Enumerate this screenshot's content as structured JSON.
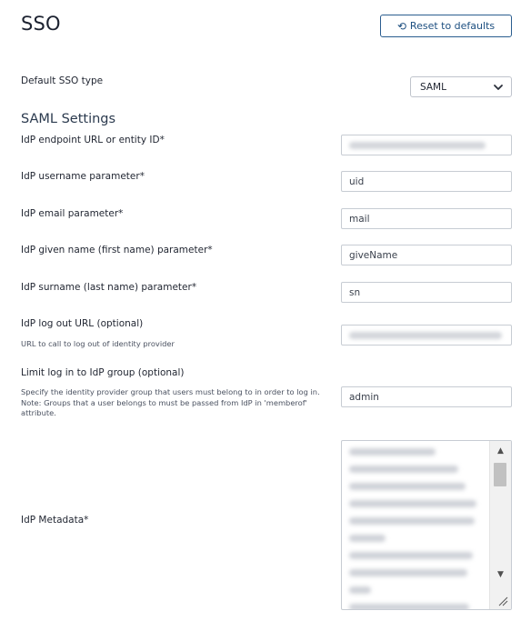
{
  "page": {
    "title": "SSO"
  },
  "toolbar": {
    "reset_label": "Reset to defaults",
    "reset_icon": "undo-icon"
  },
  "sso_type": {
    "label": "Default SSO type",
    "value": "SAML",
    "icon": "chevron-down-icon"
  },
  "saml": {
    "section_title": "SAML Settings",
    "endpoint": {
      "label": "IdP endpoint URL or entity ID*",
      "value_redacted": true
    },
    "username": {
      "label": "IdP username parameter*",
      "value": "uid"
    },
    "email": {
      "label": "IdP email parameter*",
      "value": "mail"
    },
    "given_name": {
      "label": "IdP given name (first name) parameter*",
      "value": "giveName"
    },
    "surname": {
      "label": "IdP surname (last name) parameter*",
      "value": "sn"
    },
    "logout": {
      "label": "IdP log out URL (optional)",
      "help": "URL to call to log out of identity provider",
      "value_redacted": true
    },
    "group": {
      "label": "Limit log in to IdP group (optional)",
      "help": "Specify the identity provider group that users must belong to in order to log in. Note: Groups that a user belongs to must be passed from IdP in 'memberof' attribute.",
      "value": "admin"
    },
    "metadata": {
      "label": "IdP Metadata*",
      "value_redacted": true
    }
  }
}
